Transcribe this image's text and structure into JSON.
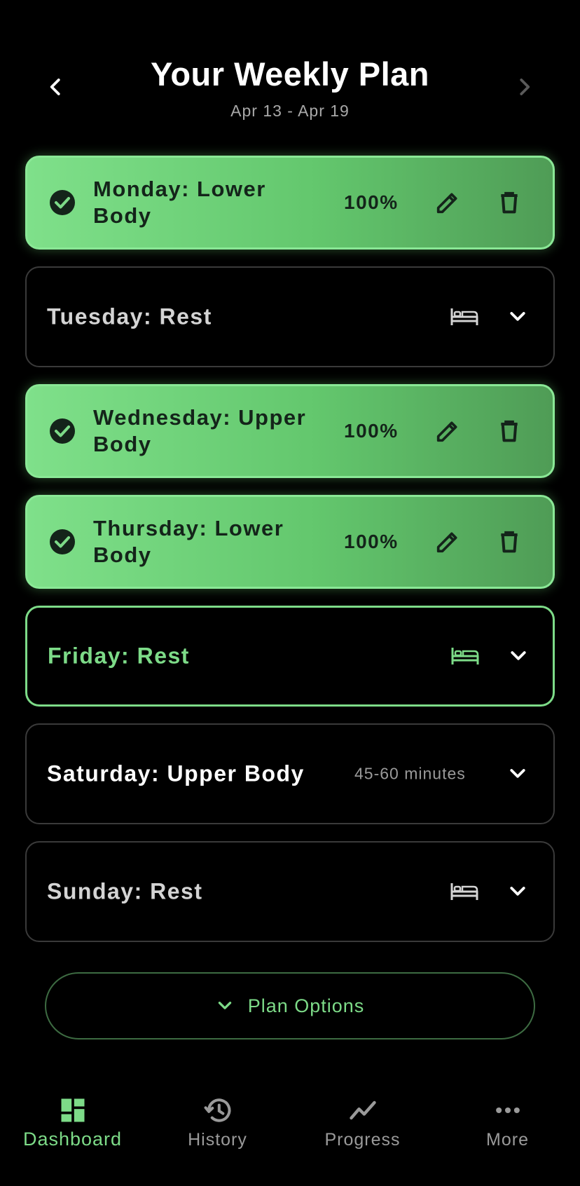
{
  "header": {
    "title": "Your Weekly Plan",
    "date_range": "Apr 13 - Apr 19"
  },
  "days": [
    {
      "title": "Monday: Lower Body",
      "status": "completed",
      "progress": "100%"
    },
    {
      "title": "Tuesday: Rest",
      "status": "rest"
    },
    {
      "title": "Wednesday: Upper Body",
      "status": "completed",
      "progress": "100%"
    },
    {
      "title": "Thursday: Lower Body",
      "status": "completed",
      "progress": "100%"
    },
    {
      "title": "Friday: Rest",
      "status": "rest-today"
    },
    {
      "title": "Saturday: Upper Body",
      "status": "upcoming",
      "duration": "45-60 minutes"
    },
    {
      "title": "Sunday: Rest",
      "status": "rest"
    }
  ],
  "plan_options_label": "Plan Options",
  "bottom_nav": [
    {
      "label": "Dashboard",
      "icon": "dashboard-icon",
      "active": true
    },
    {
      "label": "History",
      "icon": "history-icon",
      "active": false
    },
    {
      "label": "Progress",
      "icon": "trending-icon",
      "active": false
    },
    {
      "label": "More",
      "icon": "more-dots-icon",
      "active": false
    }
  ],
  "colors": {
    "background": "#000000",
    "accent": "#7ddb88",
    "completed_card": "#63c76d",
    "muted_text": "#9a9a9a"
  }
}
